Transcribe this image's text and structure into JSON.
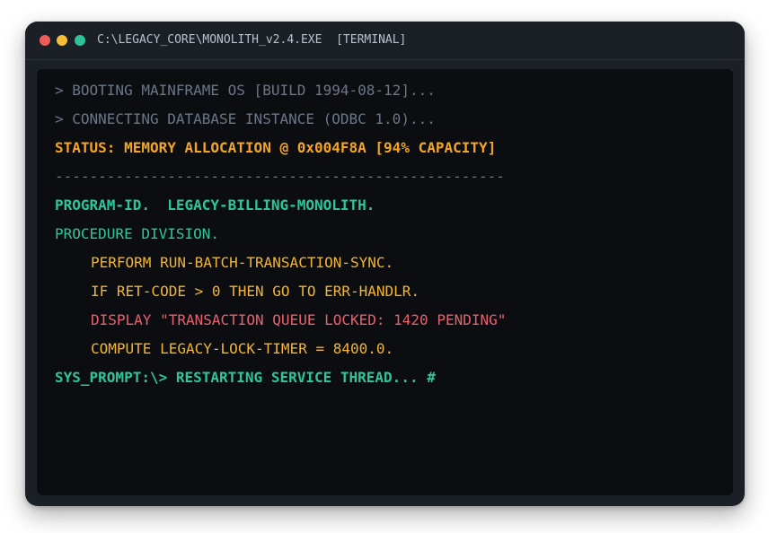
{
  "window": {
    "title": "C:\\LEGACY_CORE\\MONOLITH_v2.4.EXE  [TERMINAL]",
    "controls": [
      {
        "name": "close",
        "color": "#ed5e5a"
      },
      {
        "name": "minimize",
        "color": "#f5bc37"
      },
      {
        "name": "maximize",
        "color": "#2ec395"
      }
    ]
  },
  "colors": {
    "muted": "#6b7686",
    "amber": "#f5a524",
    "green": "#2fc59a",
    "yellow": "#f2b531",
    "red": "#e5626e"
  },
  "terminal": {
    "lines": [
      {
        "text": "> BOOTING MAINFRAME OS [BUILD 1994-08-12]...",
        "color": "muted",
        "bold": false,
        "indent": false
      },
      {
        "text": "> CONNECTING DATABASE INSTANCE (ODBC 1.0)...",
        "color": "muted",
        "bold": false,
        "indent": false
      },
      {
        "text": "STATUS: MEMORY ALLOCATION @ 0x004F8A [94% CAPACITY]",
        "color": "amber",
        "bold": true,
        "indent": false
      },
      {
        "text": "----------------------------------------------------",
        "color": "muted",
        "bold": false,
        "indent": false
      },
      {
        "text": "PROGRAM-ID.  LEGACY-BILLING-MONOLITH.",
        "color": "green",
        "bold": true,
        "indent": false
      },
      {
        "text": "PROCEDURE DIVISION.",
        "color": "green",
        "bold": false,
        "indent": false
      },
      {
        "text": "PERFORM RUN-BATCH-TRANSACTION-SYNC.",
        "color": "yellow",
        "bold": false,
        "indent": true
      },
      {
        "text": "IF RET-CODE > 0 THEN GO TO ERR-HANDLR.",
        "color": "yellow",
        "bold": false,
        "indent": true
      },
      {
        "text": "DISPLAY \"TRANSACTION QUEUE LOCKED: 1420 PENDING\"",
        "color": "red",
        "bold": false,
        "indent": true
      },
      {
        "text": "COMPUTE LEGACY-LOCK-TIMER = 8400.0.",
        "color": "yellow",
        "bold": false,
        "indent": true
      },
      {
        "text": "SYS_PROMPT:\\> RESTARTING SERVICE THREAD... #",
        "color": "green",
        "bold": true,
        "indent": false
      }
    ]
  }
}
